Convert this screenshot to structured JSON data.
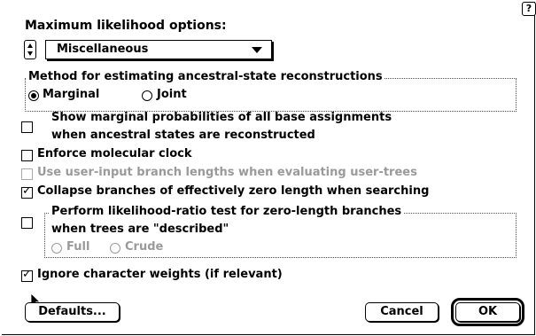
{
  "dialog": {
    "title": "Maximum likelihood options:",
    "help_icon_glyph": "?",
    "category_popup": {
      "selected": "Miscellaneous"
    }
  },
  "ancestral_group": {
    "label": "Method for estimating ancestral-state reconstructions",
    "options": [
      {
        "label": "Marginal",
        "selected": true
      },
      {
        "label": "Joint",
        "selected": false
      }
    ]
  },
  "options": {
    "show_marginal_line1": "Show marginal probabilities of all base assignments",
    "show_marginal_line2": "when ancestral states are reconstructed",
    "enforce_clock": "Enforce molecular clock",
    "use_input_lengths": "Use user-input branch lengths when evaluating user-trees",
    "collapse_zero": "Collapse branches of effectively zero length when searching",
    "lrt_line1": "Perform likelihood-ratio test for zero-length branches",
    "lrt_line2": "when trees are \"described\"",
    "lrt_full": "Full",
    "lrt_crude": "Crude",
    "ignore_weights": "Ignore character weights (if relevant)"
  },
  "checked": {
    "show_marginal": false,
    "enforce_clock": false,
    "use_input_lengths": false,
    "collapse_zero": true,
    "lrt": false,
    "ignore_weights": true
  },
  "buttons": {
    "defaults": "Defaults...",
    "cancel": "Cancel",
    "ok": "OK"
  },
  "icons": {
    "stepper": "stepper-icon",
    "popup_arrow": "chevron-down-icon",
    "help": "help-icon",
    "cursor": "mouse-pointer-icon"
  }
}
